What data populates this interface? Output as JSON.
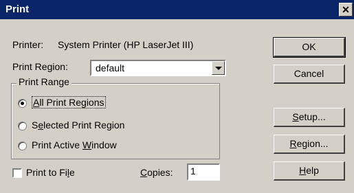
{
  "window": {
    "title": "Print",
    "close": "✕"
  },
  "printer": {
    "label": "Printer:",
    "name": "System Printer (HP LaserJet III)"
  },
  "region": {
    "label": "Print Region:",
    "value": "default"
  },
  "range": {
    "title": "Print Range",
    "options": [
      {
        "pre": "",
        "mn": "A",
        "post": "ll Print Regions",
        "selected": true
      },
      {
        "pre": "S",
        "mn": "e",
        "post": "lected Print Region",
        "selected": false
      },
      {
        "pre": "Print Active ",
        "mn": "W",
        "post": "indow",
        "selected": false
      }
    ]
  },
  "print_to_file": {
    "pre": "Print to Fi",
    "mn": "l",
    "post": "e",
    "checked": false
  },
  "copies": {
    "pre": "",
    "mn": "C",
    "post": "opies:",
    "value": "1"
  },
  "buttons": [
    {
      "pre": "OK",
      "mn": "",
      "post": ""
    },
    {
      "pre": "Cancel",
      "mn": "",
      "post": ""
    },
    {
      "pre": "",
      "mn": "S",
      "post": "etup..."
    },
    {
      "pre": "",
      "mn": "R",
      "post": "egion..."
    },
    {
      "pre": "",
      "mn": "H",
      "post": "elp"
    }
  ]
}
